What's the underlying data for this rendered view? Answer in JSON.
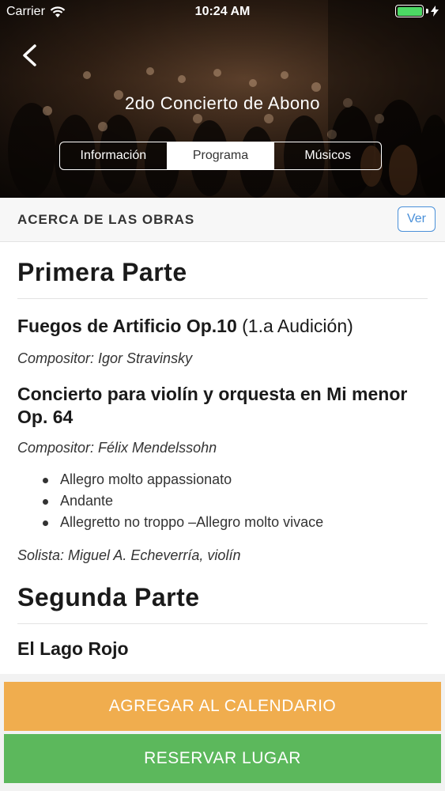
{
  "status_bar": {
    "carrier": "Carrier",
    "time": "10:24 AM",
    "battery_color": "#4cd964"
  },
  "header": {
    "title": "2do Concierto de Abono",
    "back_icon": "chevron-left-icon",
    "tabs": [
      {
        "label": "Información",
        "active": false
      },
      {
        "label": "Programa",
        "active": true
      },
      {
        "label": "Músicos",
        "active": false
      }
    ]
  },
  "section": {
    "title": "ACERCA DE LAS OBRAS",
    "view_button": "Ver",
    "accent": "#4a90d9"
  },
  "program": {
    "part1": {
      "heading": "Primera Parte",
      "work1": {
        "title": "Fuegos de Artificio Op.10",
        "note": "(1.a Audición)",
        "composer": "Compositor: Igor Stravinsky"
      },
      "work2": {
        "title": "Concierto para violín y orquesta en Mi menor Op. 64",
        "composer": "Compositor: Félix Mendelssohn",
        "movements": [
          "Allegro molto appassionato",
          "Andante",
          "Allegretto no troppo –Allegro molto vivace"
        ],
        "soloist": "Solista: Miguel A. Echeverría, violín"
      }
    },
    "part2": {
      "heading": "Segunda Parte",
      "next_work_partial": "El Lago Rojo"
    }
  },
  "actions": {
    "calendar_label": "AGREGAR AL CALENDARIO",
    "calendar_color": "#f0ad4e",
    "reserve_label": "RESERVAR LUGAR",
    "reserve_color": "#5cb85c"
  }
}
